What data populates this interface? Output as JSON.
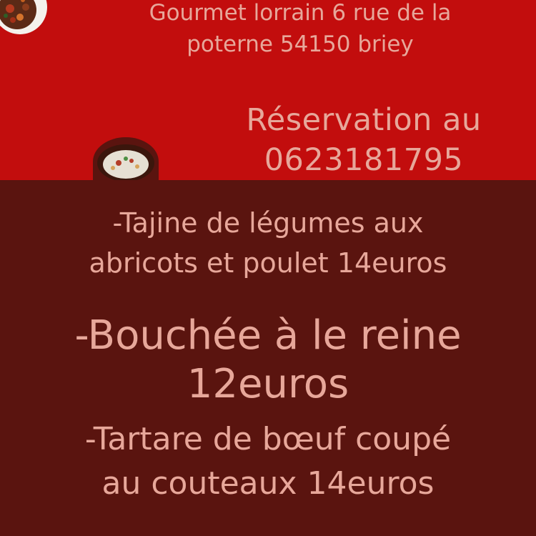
{
  "colors": {
    "top_background": "#c20d0d",
    "bottom_background": "#5a140f",
    "text": "#e7a79a"
  },
  "header": {
    "address_line1": "Gourmet lorrain 6 rue de la",
    "address_line2": "poterne 54150 briey",
    "reservation_line1": "Réservation au",
    "reservation_line2": "0623181795"
  },
  "menu": {
    "item1_line1": "-Tajine de légumes aux",
    "item1_line2": "abricots et poulet 14euros",
    "item2_line1": "-Bouchée à le reine",
    "item2_line2": "12euros",
    "item3_line1": "-Tartare de bœuf coupé",
    "item3_line2": "au couteaux 14euros"
  },
  "images": {
    "top_left_photo": "food-photo-icon",
    "middle_photo": "food-photo-icon"
  }
}
